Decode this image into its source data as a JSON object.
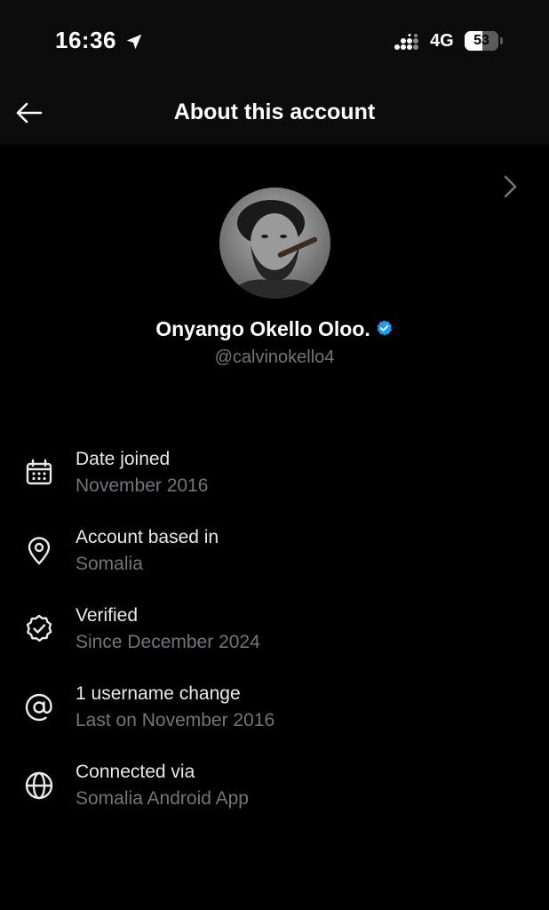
{
  "status_bar": {
    "time": "16:36",
    "network": "4G",
    "battery": "53",
    "battery_level": 0.53,
    "icons": [
      "location-arrow-icon",
      "signal-icon",
      "battery-icon"
    ]
  },
  "header": {
    "title": "About this account",
    "back_icon": "arrow-left-icon"
  },
  "profile": {
    "name": "Onyango Okello Oloo.",
    "handle": "@calvinokello4",
    "verified": true,
    "badge_color": "#1d9bf0"
  },
  "info_items": [
    {
      "label": "Date joined",
      "value": "November 2016",
      "icon": "calendar-icon"
    },
    {
      "label": "Account based in",
      "value": "Somalia",
      "icon": "location-pin-icon"
    },
    {
      "label": "Verified",
      "value": "Since December 2024",
      "icon": "verified-check-icon",
      "has_chevron": true
    },
    {
      "label": "1 username change",
      "value": "Last on November 2016",
      "icon": "at-sign-icon"
    },
    {
      "label": "Connected via",
      "value": "Somalia Android App",
      "icon": "globe-icon"
    }
  ],
  "colors": {
    "background": "#000000",
    "header_bg": "#0c0c0c",
    "primary_text": "#e7e9ea",
    "secondary_text": "#71767b",
    "accent": "#1d9bf0"
  }
}
